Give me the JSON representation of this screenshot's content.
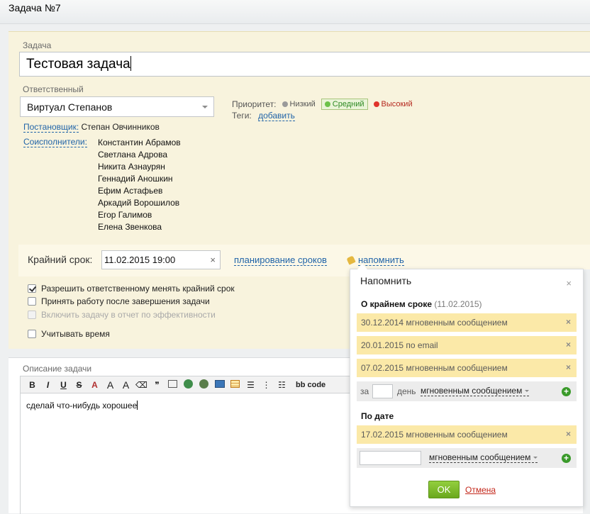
{
  "window": {
    "title": "Задача №7"
  },
  "task": {
    "label": "Задача",
    "title": "Тестовая задача"
  },
  "responsible": {
    "label": "Ответственный",
    "value": "Виртуал Степанов"
  },
  "priority": {
    "label": "Приоритет:",
    "options": [
      {
        "label": "Низкий",
        "color": "#9a9a9a",
        "active": false
      },
      {
        "label": "Средний",
        "color": "#6cc24a",
        "active": true
      },
      {
        "label": "Высокий",
        "color": "#e0342b",
        "active": false
      }
    ]
  },
  "tags": {
    "label": "Теги:",
    "add_link": "добавить"
  },
  "creator": {
    "label": "Постановщик:",
    "name": "Степан Овчинников"
  },
  "coexecutors": {
    "label": "Соисполнители:",
    "names": [
      "Константин Абрамов",
      "Светлана Адрова",
      "Никита Азнаурян",
      "Геннадий Аношкин",
      "Ефим Астафьев",
      "Аркадий Ворошилов",
      "Егор Галимов",
      "Елена Звенкова"
    ]
  },
  "deadline": {
    "label": "Крайний срок:",
    "value": "11.02.2015 19:00",
    "planning_link": "планирование сроков",
    "remind_link": "напомнить"
  },
  "options": [
    {
      "label": "Разрешить ответственному менять крайний срок",
      "checked": true,
      "disabled": false
    },
    {
      "label": "Принять работу после завершения задачи",
      "checked": false,
      "disabled": false
    },
    {
      "label": "Включить задачу в отчет по эффективности",
      "checked": false,
      "disabled": true
    },
    {
      "label": "Учитывать время",
      "checked": false,
      "disabled": false
    }
  ],
  "description": {
    "label": "Описание задачи",
    "toolbar": {
      "bold": "B",
      "italic": "I",
      "underline": "U",
      "strike": "S",
      "font_color": "A",
      "font_size": "A",
      "font_family": "A",
      "bbcode": "bb code"
    },
    "text": "сделай что-нибудь хорошее"
  },
  "remind_popup": {
    "title": "Напомнить",
    "close_icon": "×",
    "deadline_section": {
      "title": "О крайнем сроке",
      "date": "(11.02.2015)"
    },
    "deadline_reminders": [
      "30.12.2014 мгновенным сообщением",
      "20.01.2015 по email",
      "07.02.2015 мгновенным сообщением"
    ],
    "add_relative": {
      "prefix": "за",
      "unit": "день",
      "via": "мгновенным сообщением"
    },
    "date_section": {
      "title": "По дате"
    },
    "date_reminders": [
      "17.02.2015 мгновенным сообщением"
    ],
    "add_date": {
      "via": "мгновенным сообщением"
    },
    "ok_label": "OK",
    "cancel_label": "Отмена",
    "remove_icon": "×",
    "add_icon": "+"
  }
}
